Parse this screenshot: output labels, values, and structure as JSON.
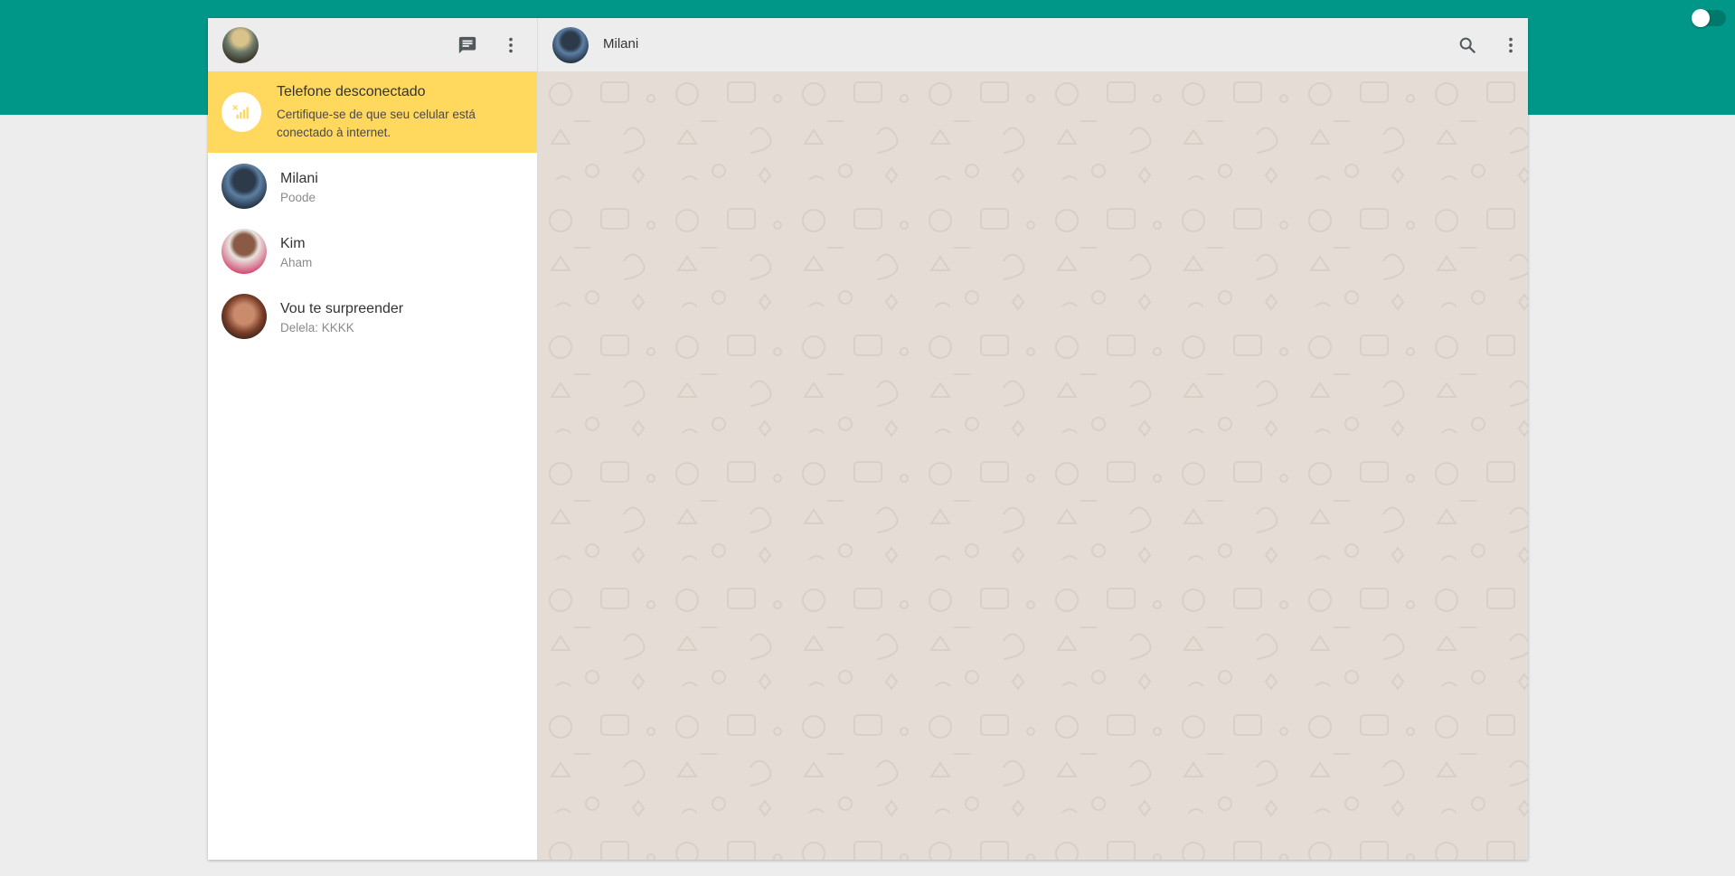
{
  "colors": {
    "accent": "#009688",
    "banner": "#ffd85d",
    "chat_background": "#e5ddd5",
    "header_background": "#ededed"
  },
  "theme_toggle": {
    "state": "off",
    "icon": "toggle-switch"
  },
  "sidebar": {
    "header_icons": [
      "new-chat-icon",
      "menu-dots-icon"
    ],
    "banner": {
      "icon": "signal-off-icon",
      "title": "Telefone desconectado",
      "text": "Certifique-se de que seu celular está conectado à internet."
    },
    "chats": [
      {
        "name": "Milani",
        "last_message": "Poode",
        "avatar": "avatar-milani"
      },
      {
        "name": "Kim",
        "last_message": "Aham",
        "avatar": "avatar-kim"
      },
      {
        "name": "Vou te surpreender",
        "last_message": "Delela: KKKK",
        "avatar": "avatar-group"
      }
    ]
  },
  "conversation": {
    "contact_name": "Milani",
    "header_icons": [
      "search-icon",
      "menu-dots-icon"
    ]
  }
}
